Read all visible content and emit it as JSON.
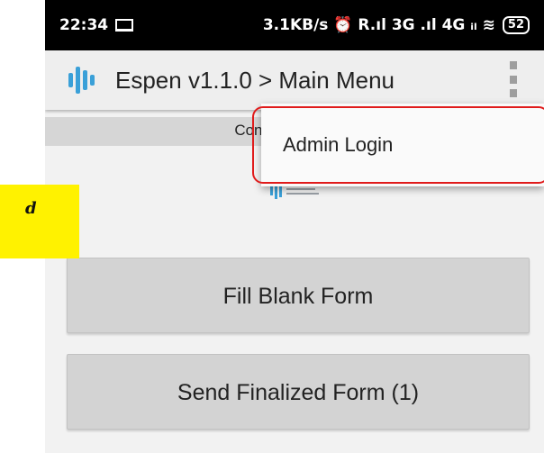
{
  "status_bar": {
    "time": "22:34",
    "right_text": "3.1KB/s ⏰ R.ıl 3G .ıl 4G ᵢₗ ≋",
    "battery": "52"
  },
  "app_bar": {
    "title": "Espen v1.1.0 > Main Menu",
    "logo_color": "#3aa0d8"
  },
  "connection_strip": {
    "text": "Connect"
  },
  "overflow_menu": {
    "items": [
      "Admin Login"
    ]
  },
  "main": {
    "buttons": [
      "Fill Blank Form",
      "Send Finalized Form (1)"
    ]
  },
  "annotation": {
    "label": "d"
  }
}
